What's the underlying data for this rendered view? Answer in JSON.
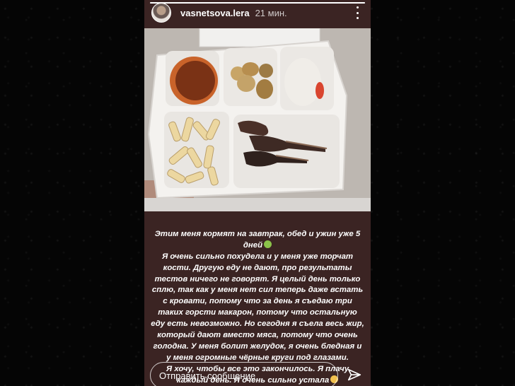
{
  "story": {
    "progress": 1.0,
    "username": "vasnetsova.lera",
    "time": "21 мин.",
    "more_icon": "more-vertical-icon",
    "photo_subject": "food-tray-photo",
    "caption": {
      "line_1": "Этим меня кормят на завтрак, обед и ужин уже 5 дней",
      "emoji_1": "nauseated-face-emoji",
      "paragraph": "Я очень сильно похудела и у меня уже торчат кости. Другую еду не дают, про результаты тестов ничего не говорят. Я целый день только сплю, так как у меня нет сил теперь даже встать с кровати, потому что за день я съедаю три таких горсти макарон, потому что остальную еду есть невозможно. Но сегодня я съела весь жир, который дают вместо мяса, потому что очень голодна. У меня болит желудок, я очень бледная и у меня огромные чёрные круги под глазами.",
      "line_last": "Я хочу, чтобы все это закончилось. Я плачу каждый день. Я очень сильно устала",
      "emoji_2": "tired-face-emoji"
    },
    "reply_placeholder": "Отправить сообщение",
    "send_icon": "send-icon"
  },
  "colors": {
    "page_background": "#050505",
    "story_background": "#3b2423",
    "text": "#ffffff"
  }
}
